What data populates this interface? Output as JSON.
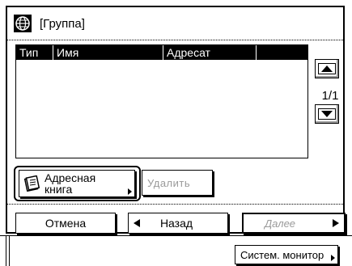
{
  "header": {
    "title": "[Группа]",
    "icon": "globe-icon"
  },
  "list": {
    "columns": [
      "Тип",
      "Имя",
      "Адресат"
    ],
    "rows": []
  },
  "pagination": {
    "page_indicator": "1/1",
    "up_icon": "triangle-up-icon",
    "down_icon": "triangle-down-icon"
  },
  "actions": {
    "address_book_line1": "Адресная",
    "address_book_line2": "книга",
    "delete_label": "Удалить"
  },
  "nav": {
    "cancel_label": "Отмена",
    "back_label": "Назад",
    "next_label": "Далее"
  },
  "status_bar": {
    "system_monitor_label": "Систем. монитор"
  }
}
